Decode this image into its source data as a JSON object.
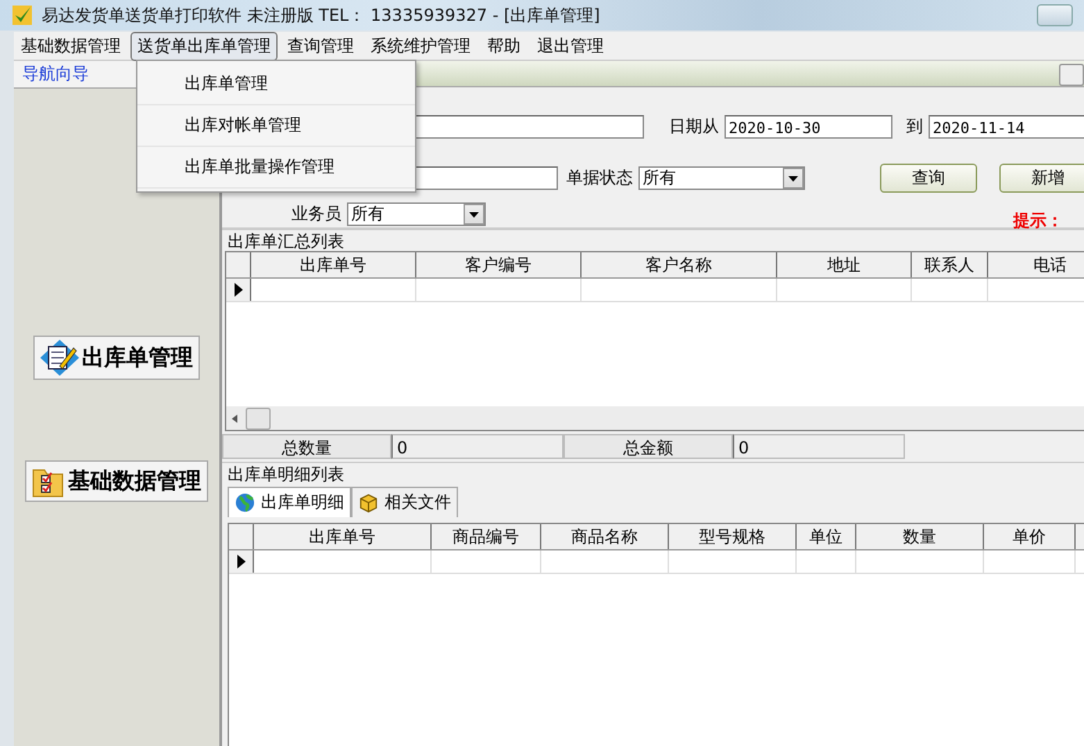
{
  "window": {
    "title": "易达发货单送货单打印软件 未注册版 TEL： 13335939327  - [出库单管理]"
  },
  "menu": [
    {
      "label": "基础数据管理",
      "selected": false
    },
    {
      "label": "送货单出库单管理",
      "selected": true
    },
    {
      "label": "查询管理",
      "selected": false
    },
    {
      "label": "系统维护管理",
      "selected": false
    },
    {
      "label": "帮助",
      "selected": false
    },
    {
      "label": "退出管理",
      "selected": false
    }
  ],
  "dropdown": [
    {
      "label": "出库单管理"
    },
    {
      "label": "出库对帐单管理"
    },
    {
      "label": "出库单批量操作管理"
    }
  ],
  "nav": {
    "title": "导航向导",
    "buttons": [
      {
        "label": "出库单管理"
      },
      {
        "label": "基础数据管理"
      }
    ]
  },
  "filters": {
    "date_from": {
      "label": "日期从",
      "value": "2020-10-30"
    },
    "date_to": {
      "label": "到",
      "value": "2020-11-14"
    },
    "status": {
      "label": "单据状态",
      "value": "所有"
    },
    "salesperson": {
      "label": "业务员",
      "value": "所有"
    }
  },
  "buttons": [
    "查询",
    "新增"
  ],
  "hint": "提示：",
  "summary": {
    "title": "出库单汇总列表",
    "columns": [
      "出库单号",
      "客户编号",
      "客户名称",
      "地址",
      "联系人",
      "电话"
    ],
    "rows": [
      {
        "selected": true
      }
    ]
  },
  "totals": [
    {
      "label": "总数量",
      "value": "0"
    },
    {
      "label": "总金额",
      "value": "0"
    }
  ],
  "detail": {
    "title": "出库单明细列表",
    "tabs": [
      {
        "label": "出库单明细",
        "selected": true
      },
      {
        "label": "相关文件",
        "selected": false
      }
    ],
    "columns": [
      "出库单号",
      "商品编号",
      "商品名称",
      "型号规格",
      "单位",
      "数量",
      "单价"
    ],
    "rows": [
      {
        "selected": true
      }
    ]
  }
}
